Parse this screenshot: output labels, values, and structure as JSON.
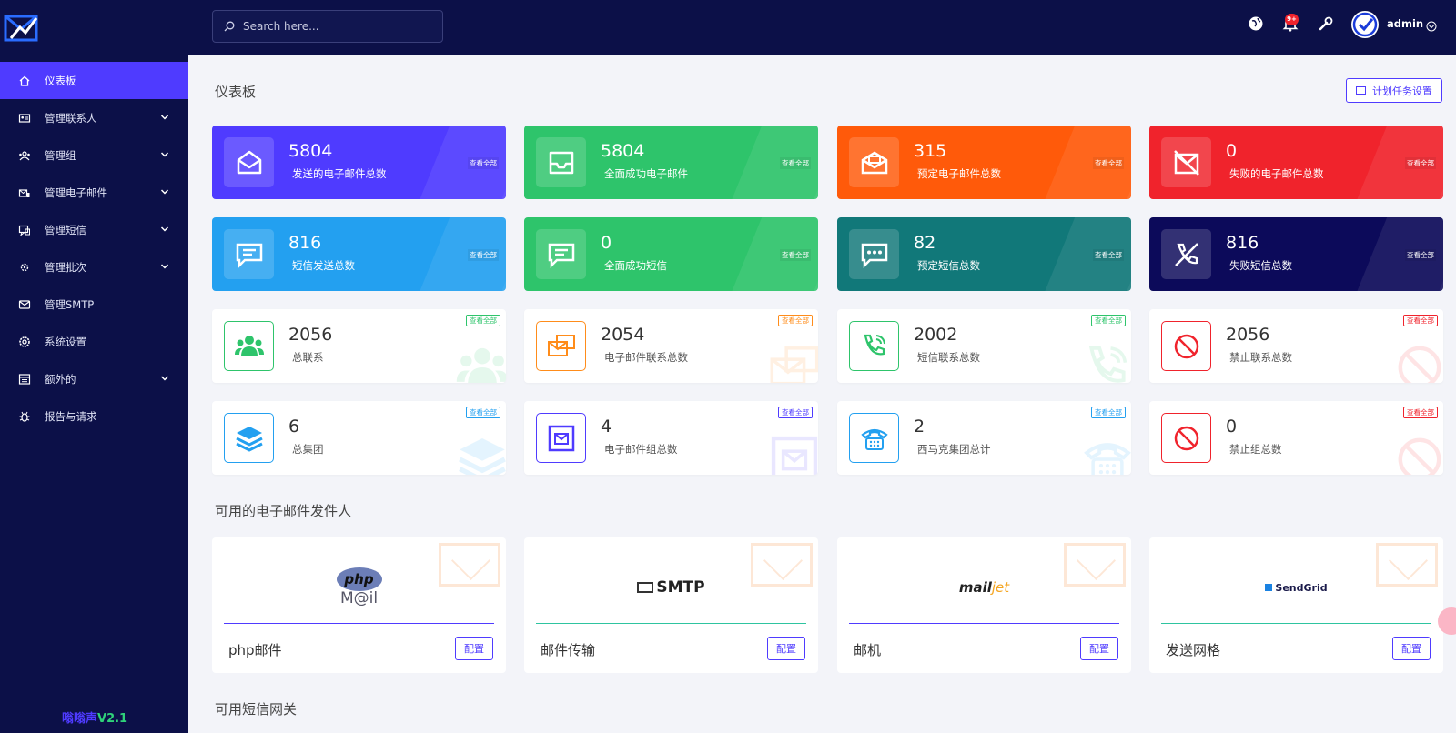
{
  "sidebar": {
    "items": [
      {
        "label": "仪表板",
        "icon": "home-icon",
        "active": true
      },
      {
        "label": "管理联系人",
        "icon": "contact-card-icon",
        "chev": true
      },
      {
        "label": "管理组",
        "icon": "group-icon",
        "chev": true
      },
      {
        "label": "管理电子邮件",
        "icon": "email-manage-icon",
        "chev": true
      },
      {
        "label": "管理短信",
        "icon": "sms-icon",
        "chev": true
      },
      {
        "label": "管理批次",
        "icon": "batch-icon",
        "chev": true
      },
      {
        "label": "管理SMTP",
        "icon": "mail-icon"
      },
      {
        "label": "系统设置",
        "icon": "settings-icon"
      },
      {
        "label": "额外的",
        "icon": "extra-icon",
        "chev": true
      },
      {
        "label": "报告与请求",
        "icon": "bug-icon"
      }
    ],
    "version_a": "嗡嗡声",
    "version_b": "V2.1"
  },
  "topbar": {
    "search_placeholder": "Search here...",
    "notif_badge": "9+",
    "user": "admin"
  },
  "main": {
    "title": "仪表板",
    "schedule_button": "计划任务设置"
  },
  "stat_cards": [
    {
      "num": "5804",
      "label": "发送的电子邮件总数",
      "view": "查看全部",
      "color": "#4f3bff",
      "icon": "envelope-open-icon"
    },
    {
      "num": "5804",
      "label": "全面成功电子邮件",
      "view": "查看全部",
      "color": "#2ec46b",
      "icon": "inbox-icon"
    },
    {
      "num": "315",
      "label": "预定电子邮件总数",
      "view": "查看全部",
      "color": "#ff5a0a",
      "icon": "mail-schedule-icon"
    },
    {
      "num": "0",
      "label": "失败的电子邮件总数",
      "view": "查看全部",
      "color": "#f0232c",
      "icon": "mail-failed-icon"
    },
    {
      "num": "816",
      "label": "短信发送总数",
      "view": "查看全部",
      "color": "#23a0f0",
      "icon": "message-icon"
    },
    {
      "num": "0",
      "label": "全面成功短信",
      "view": "查看全部",
      "color": "#2ec46b",
      "icon": "message-success-icon"
    },
    {
      "num": "82",
      "label": "预定短信总数",
      "view": "查看全部",
      "color": "#117879",
      "icon": "message-dots-icon"
    },
    {
      "num": "816",
      "label": "失败短信总数",
      "view": "查看全部",
      "color": "#0c0a5a",
      "icon": "phone-off-icon"
    }
  ],
  "contact_cards": [
    {
      "num": "2056",
      "label": "总联系",
      "view": "查看全部",
      "color": "#2ec46b",
      "icon": "users-icon"
    },
    {
      "num": "2054",
      "label": "电子邮件联系总数",
      "view": "查看全部",
      "color": "#ff8c1a",
      "icon": "mail-stack-icon"
    },
    {
      "num": "2002",
      "label": "短信联系总数",
      "view": "查看全部",
      "color": "#2ec46b",
      "icon": "phone-call-icon"
    },
    {
      "num": "2056",
      "label": "禁止联系总数",
      "view": "查看全部",
      "color": "#f0232c",
      "icon": "ban-icon"
    },
    {
      "num": "6",
      "label": "总集团",
      "view": "查看全部",
      "color": "#23a0f0",
      "icon": "layers-icon"
    },
    {
      "num": "4",
      "label": "电子邮件组总数",
      "view": "查看全部",
      "color": "#4f3bff",
      "icon": "mail-box-icon"
    },
    {
      "num": "2",
      "label": "西马克集团总计",
      "view": "查看全部",
      "color": "#23a0f0",
      "icon": "telephone-icon"
    },
    {
      "num": "0",
      "label": "禁止组总数",
      "view": "查看全部",
      "color": "#f0232c",
      "icon": "ban-icon"
    }
  ],
  "senders_title": "可用的电子邮件发件人",
  "senders": [
    {
      "name": "php邮件",
      "button": "配置",
      "logo_top": "php",
      "logo_bottom": "M@il",
      "rule": "#4f3bff"
    },
    {
      "name": "邮件传输",
      "button": "配置",
      "logo_top": "SMTP",
      "rule": "#2ec4a0"
    },
    {
      "name": "邮机",
      "button": "配置",
      "logo_top": "mail",
      "logo_bottom": "jet",
      "rule": "#4f3bff"
    },
    {
      "name": "发送网格",
      "button": "配置",
      "logo_top": "SendGrid",
      "rule": "#2ec4a0"
    }
  ],
  "sms_title": "可用短信网关"
}
